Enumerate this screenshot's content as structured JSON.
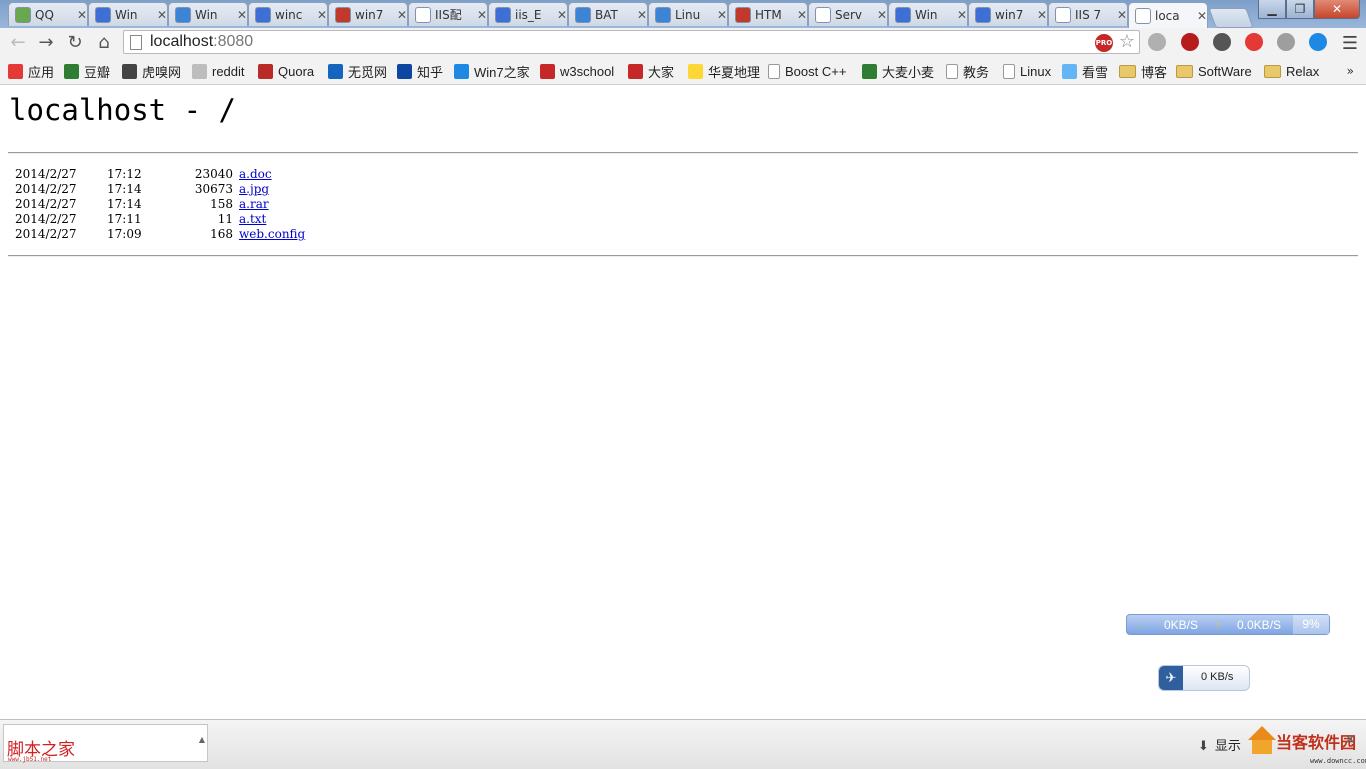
{
  "browser": {
    "tabs": [
      {
        "label": "QQ",
        "favicon_color": "#6aa84f",
        "active": false
      },
      {
        "label": "Win",
        "favicon_color": "#3d6fd6",
        "active": false
      },
      {
        "label": "Win",
        "favicon_color": "#3d84d6",
        "active": false
      },
      {
        "label": "winc",
        "favicon_color": "#3d6fd6",
        "active": false
      },
      {
        "label": "win7",
        "favicon_color": "#c0392b",
        "active": false
      },
      {
        "label": "IIS配",
        "favicon_color": "#ffffff",
        "active": false
      },
      {
        "label": "iis_E",
        "favicon_color": "#3d6fd6",
        "active": false
      },
      {
        "label": "BAT",
        "favicon_color": "#3d84d6",
        "active": false
      },
      {
        "label": "Linu",
        "favicon_color": "#3d84d6",
        "active": false
      },
      {
        "label": "HTM",
        "favicon_color": "#c0392b",
        "active": false
      },
      {
        "label": "Serv",
        "favicon_color": "#ffffff",
        "active": false
      },
      {
        "label": "Win",
        "favicon_color": "#3d6fd6",
        "active": false
      },
      {
        "label": "win7",
        "favicon_color": "#3d6fd6",
        "active": false
      },
      {
        "label": "IIS 7",
        "favicon_color": "#ffffff",
        "active": false
      },
      {
        "label": "loca",
        "favicon_color": "#ffffff",
        "active": true
      }
    ],
    "tab_close_glyph": "✕",
    "window_controls": {
      "minimize": "▁",
      "maximize": "❐",
      "close": "✕"
    },
    "address": {
      "host": "localhost",
      "port": ":8080",
      "pro_badge": "PRO"
    },
    "extensions": [
      {
        "name": "globe-icon",
        "color": "#b0b0b0"
      },
      {
        "name": "puzzle-red-icon",
        "color": "#b71c1c"
      },
      {
        "name": "steering-wheel-icon",
        "color": "#555555"
      },
      {
        "name": "red-box-icon",
        "color": "#e53935"
      },
      {
        "name": "leaf-icon",
        "color": "#9e9e9e"
      },
      {
        "name": "compass-icon",
        "color": "#1e88e5"
      }
    ]
  },
  "bookmarks": [
    {
      "label": "应用",
      "icon": "apps-icon",
      "color": "#e53935"
    },
    {
      "label": "豆瓣",
      "icon": "douban-icon",
      "color": "#2e7d32"
    },
    {
      "label": "虎嗅网",
      "icon": "huxiu-icon",
      "color": "#444444"
    },
    {
      "label": "reddit",
      "icon": "reddit-icon",
      "color": "#bdbdbd"
    },
    {
      "label": "Quora",
      "icon": "quora-icon",
      "color": "#b92b27"
    },
    {
      "label": "无觅网",
      "icon": "wumii-icon",
      "color": "#1565c0"
    },
    {
      "label": "知乎",
      "icon": "zhihu-icon",
      "color": "#0d47a1"
    },
    {
      "label": "Win7之家",
      "icon": "win7-icon",
      "color": "#1e88e5"
    },
    {
      "label": "w3school",
      "icon": "w3school-icon",
      "color": "#c62828"
    },
    {
      "label": "大家",
      "icon": "dajia-icon",
      "color": "#c62828"
    },
    {
      "label": "华夏地理",
      "icon": "natgeo-icon",
      "color": "#fdd835"
    },
    {
      "label": "Boost C++",
      "icon": "page-icon",
      "color": "#ffffff"
    },
    {
      "label": "大麦小麦",
      "icon": "damai-icon",
      "color": "#2e7d32"
    },
    {
      "label": "教务",
      "icon": "page-icon",
      "color": "#ffffff"
    },
    {
      "label": "Linux",
      "icon": "page-icon",
      "color": "#ffffff"
    },
    {
      "label": "看雪",
      "icon": "snowflake-icon",
      "color": "#64b5f6"
    },
    {
      "label": "博客",
      "icon": "folder-icon",
      "color": "#e8c86a"
    },
    {
      "label": "SoftWare",
      "icon": "folder-icon",
      "color": "#e8c86a"
    },
    {
      "label": "Relax",
      "icon": "folder-icon",
      "color": "#e8c86a"
    }
  ],
  "bookmarks_more": "»",
  "page": {
    "title": "localhost - /",
    "entries": [
      {
        "date": "2014/2/27",
        "time": "17:12",
        "size": "23040",
        "name": "a.doc"
      },
      {
        "date": "2014/2/27",
        "time": "17:14",
        "size": "30673",
        "name": "a.jpg"
      },
      {
        "date": "2014/2/27",
        "time": "17:14",
        "size": "158",
        "name": "a.rar"
      },
      {
        "date": "2014/2/27",
        "time": "17:11",
        "size": "11",
        "name": "a.txt"
      },
      {
        "date": "2014/2/27",
        "time": "17:09",
        "size": "168",
        "name": "web.config"
      }
    ]
  },
  "speed_widget": {
    "down": "0KB/S",
    "up": "0.0KB/S",
    "percent": "9%"
  },
  "thunder_widget": {
    "speed": "0 KB/s"
  },
  "download_bar": {
    "item_logo_text": "脚本之家",
    "item_logo_url": "www.jb51.net",
    "show_all": "显示",
    "watermark_text": "当客软件园",
    "watermark_url": "www.downcc.com"
  }
}
